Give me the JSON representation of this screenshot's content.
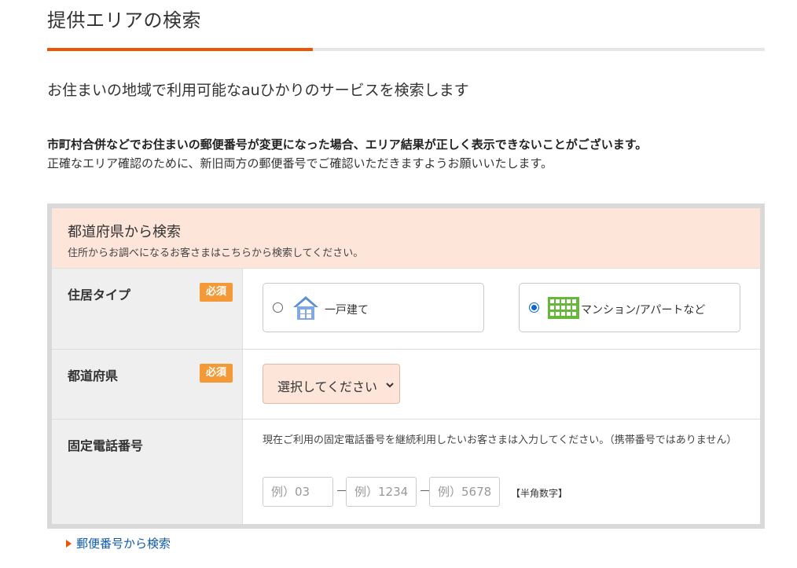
{
  "page": {
    "title": "提供エリアの検索",
    "lead": "お住まいの地域で利用可能なauひかりのサービスを検索します",
    "notice_strong": "市町村合併などでお住まいの郵便番号が変更になった場合、エリア結果が正しく表示できないことがございます。",
    "notice_normal": "正確なエリア確認のために、新旧両方の郵便番号でご確認いただきますようお願いいたします。"
  },
  "colors": {
    "accent": "#eb5505",
    "required_badge": "#f49937",
    "form_header_bg": "#fde5da",
    "link": "#0f5aa8"
  },
  "form": {
    "header_title": "都道府県から検索",
    "header_sub": "住所からお調べになるお客さまはこちらから検索してください。",
    "required_label": "必須",
    "residence": {
      "label": "住居タイプ",
      "options": [
        {
          "label": "一戸建て",
          "icon": "house-icon",
          "selected": false
        },
        {
          "label": "マンション/アパートなど",
          "icon": "apartment-building-icon",
          "selected": true
        }
      ]
    },
    "prefecture": {
      "label": "都道府県",
      "selected_value": "選択してください"
    },
    "phone": {
      "label": "固定電話番号",
      "note": "現在ご利用の固定電話番号を継続利用したいお客さまは入力してください。（携帯番号ではありません）",
      "placeholders": [
        "例）03",
        "例）1234",
        "例）5678"
      ],
      "separator": "－",
      "hint": "【半角数字】"
    }
  },
  "postal_link": "郵便番号から検索"
}
